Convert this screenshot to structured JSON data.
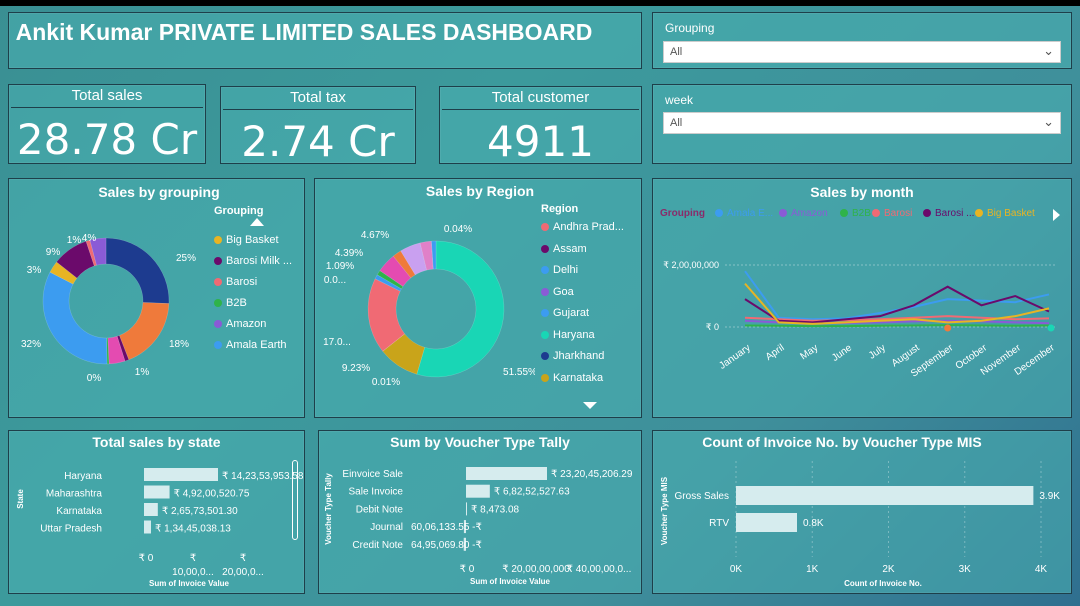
{
  "header": {
    "title": "Ankit Kumar PRIVATE LIMITED SALES DASHBOARD"
  },
  "kpis": [
    {
      "label": "Total sales",
      "value": "28.78 Cr"
    },
    {
      "label": "Total tax",
      "value": "2.74 Cr"
    },
    {
      "label": "Total customer",
      "value": "4911"
    }
  ],
  "filters": {
    "grouping": {
      "label": "Grouping",
      "value": "All"
    },
    "week": {
      "label": "week",
      "value": "All"
    }
  },
  "colors": {
    "big_basket": "#e8b423",
    "barosi_milk": "#6b0a6b",
    "barosi": "#f06a74",
    "b2b": "#2fb34a",
    "amazon": "#8a5bd6",
    "amala_earth": "#3c9cf0"
  },
  "sales_by_grouping": {
    "title": "Sales by grouping",
    "legend_title": "Grouping",
    "legend": [
      {
        "label": "Big Basket",
        "color": "#e8b423"
      },
      {
        "label": "Barosi Milk ...",
        "color": "#6b0a6b"
      },
      {
        "label": "Barosi",
        "color": "#f06a74"
      },
      {
        "label": "B2B",
        "color": "#2fb34a"
      },
      {
        "label": "Amazon",
        "color": "#8a5bd6"
      },
      {
        "label": "Amala Earth",
        "color": "#3c9cf0"
      }
    ],
    "slices": [
      {
        "value": 25,
        "color": "#1d3b8f"
      },
      {
        "value": 18,
        "color": "#ef7a3b"
      },
      {
        "value": 1,
        "color": "#6b0a6b"
      },
      {
        "value": 4,
        "color": "#e44bb1"
      },
      {
        "value": 0.5,
        "color": "#2fb34a"
      },
      {
        "value": 32,
        "color": "#3c9cf0"
      },
      {
        "value": 3,
        "color": "#e8b423"
      },
      {
        "value": 9,
        "color": "#6b0a6b"
      },
      {
        "value": 1,
        "color": "#f06a74"
      },
      {
        "value": 4,
        "color": "#8a5bd6"
      }
    ],
    "labels": [
      "25%",
      "18%",
      "1%",
      "0%",
      "32%",
      "3%",
      "9%",
      "1%",
      "4%"
    ]
  },
  "sales_by_region": {
    "title": "Sales by Region",
    "legend_title": "Region",
    "legend": [
      {
        "label": "Andhra Prad...",
        "color": "#f06a74"
      },
      {
        "label": "Assam",
        "color": "#6b0a6b"
      },
      {
        "label": "Delhi",
        "color": "#3c9cf0"
      },
      {
        "label": "Goa",
        "color": "#8a5bd6"
      },
      {
        "label": "Gujarat",
        "color": "#3c9cf0"
      },
      {
        "label": "Haryana",
        "color": "#19d6b5"
      },
      {
        "label": "Jharkhand",
        "color": "#1d3b8f"
      },
      {
        "label": "Karnataka",
        "color": "#c9a41a"
      }
    ],
    "slices": [
      {
        "value": 51.55,
        "color": "#19d6b5"
      },
      {
        "value": 9.23,
        "color": "#c9a41a"
      },
      {
        "value": 0.01,
        "color": "#1d3b8f"
      },
      {
        "value": 17,
        "color": "#f06a74"
      },
      {
        "value": 1,
        "color": "#3c9cf0"
      },
      {
        "value": 1.09,
        "color": "#2fb34a"
      },
      {
        "value": 4.39,
        "color": "#e44bb1"
      },
      {
        "value": 2,
        "color": "#ef7a3b"
      },
      {
        "value": 4.67,
        "color": "#c9a0f0"
      },
      {
        "value": 2.5,
        "color": "#e080c8"
      },
      {
        "value": 0.04,
        "color": "#6b0a6b"
      },
      {
        "value": 1,
        "color": "#3c9cf0"
      }
    ],
    "labels": [
      "4.67%",
      "0.04%",
      "4.39%",
      "1.09%",
      "0.0...",
      "17.0...",
      "9.23%",
      "0.01%",
      "51.55%"
    ]
  },
  "sales_by_month": {
    "title": "Sales by month",
    "legend_title": "Grouping",
    "legend": [
      {
        "label": "Amala E...",
        "color": "#3c9cf0"
      },
      {
        "label": "Amazon",
        "color": "#8a5bd6"
      },
      {
        "label": "B2B",
        "color": "#2fb34a"
      },
      {
        "label": "Barosi",
        "color": "#f06a74"
      },
      {
        "label": "Barosi ...",
        "color": "#6b0a6b"
      },
      {
        "label": "Big Basket",
        "color": "#e8b423"
      }
    ],
    "y_ticks": [
      "₹ 2,00,00,000",
      "₹ 0"
    ],
    "months": [
      "January",
      "April",
      "May",
      "June",
      "July",
      "August",
      "September",
      "October",
      "November",
      "December"
    ]
  },
  "chart_data": [
    {
      "type": "line",
      "title": "Sales by month",
      "x": [
        "January",
        "April",
        "May",
        "June",
        "July",
        "August",
        "September",
        "October",
        "November",
        "December"
      ],
      "ylim": [
        0,
        20000000
      ],
      "series": [
        {
          "name": "Amala E...",
          "color": "#3c9cf0",
          "values": [
            18000000,
            3000000,
            2500000,
            2800000,
            4500000,
            6500000,
            9000000,
            8500000,
            8000000,
            10500000
          ]
        },
        {
          "name": "Amazon",
          "color": "#8a5bd6",
          "values": [
            2000000,
            1500000,
            1200000,
            1300000,
            1500000,
            1800000,
            2000000,
            1800000,
            1500000,
            1200000
          ]
        },
        {
          "name": "B2B",
          "color": "#2fb34a",
          "values": [
            500000,
            400000,
            300000,
            300000,
            400000,
            500000,
            600000,
            500000,
            400000,
            500000
          ]
        },
        {
          "name": "Barosi",
          "color": "#f06a74",
          "values": [
            3000000,
            2500000,
            2000000,
            2200000,
            2500000,
            3000000,
            3500000,
            3000000,
            2500000,
            2800000
          ]
        },
        {
          "name": "Barosi ...",
          "color": "#6b0a6b",
          "values": [
            9000000,
            2000000,
            1500000,
            2500000,
            3500000,
            7000000,
            13000000,
            7000000,
            10000000,
            5000000
          ]
        },
        {
          "name": "Big Basket",
          "color": "#e8b423",
          "values": [
            14000000,
            1500000,
            1000000,
            1500000,
            2000000,
            2500000,
            1500000,
            2000000,
            3500000,
            6000000
          ]
        }
      ]
    },
    {
      "type": "bar",
      "title": "Total sales by state",
      "categories": [
        "Haryana",
        "Maharashtra",
        "Karnataka",
        "Uttar Pradesh"
      ],
      "values": [
        142353953.58,
        49200520.75,
        26573501.3,
        13445038.13
      ],
      "labels": [
        "₹ 14,23,53,953.58",
        "₹ 4,92,00,520.75",
        "₹ 2,65,73,501.30",
        "₹ 1,34,45,038.13"
      ],
      "xlabel": "Sum of Invoice Value",
      "ylabel": "State",
      "x_ticks": [
        "₹ 0",
        "₹ 10,00,0...",
        "₹ 20,00,0..."
      ]
    },
    {
      "type": "bar",
      "title": "Sum by Voucher Type Tally",
      "categories": [
        "Einvoice Sale",
        "Sale Invoice",
        "Debit Note",
        "Journal",
        "Credit Note"
      ],
      "values": [
        232045206.29,
        68252527.63,
        8473.08,
        -6006133.55,
        -6495069.8
      ],
      "labels": [
        "₹ 23,20,45,206.29",
        "₹ 6,82,52,527.63",
        "₹ 8,473.08",
        "60,06,133.55 -₹",
        "64,95,069.80 -₹"
      ],
      "xlabel": "Sum of Invoice Value",
      "ylabel": "Voucher Type Tally",
      "x_ticks": [
        "₹ 0",
        "₹ 20,00,00,000",
        "₹ 40,00,00,0..."
      ]
    },
    {
      "type": "bar",
      "title": "Count of Invoice No. by Voucher Type MIS",
      "categories": [
        "Gross Sales",
        "RTV"
      ],
      "values": [
        3900,
        800
      ],
      "labels": [
        "3.9K",
        "0.8K"
      ],
      "xlabel": "Count of Invoice No.",
      "ylabel": "Voucher Type MIS",
      "x_ticks": [
        "0K",
        "1K",
        "2K",
        "3K",
        "4K"
      ],
      "xlim": [
        0,
        4000
      ]
    }
  ]
}
